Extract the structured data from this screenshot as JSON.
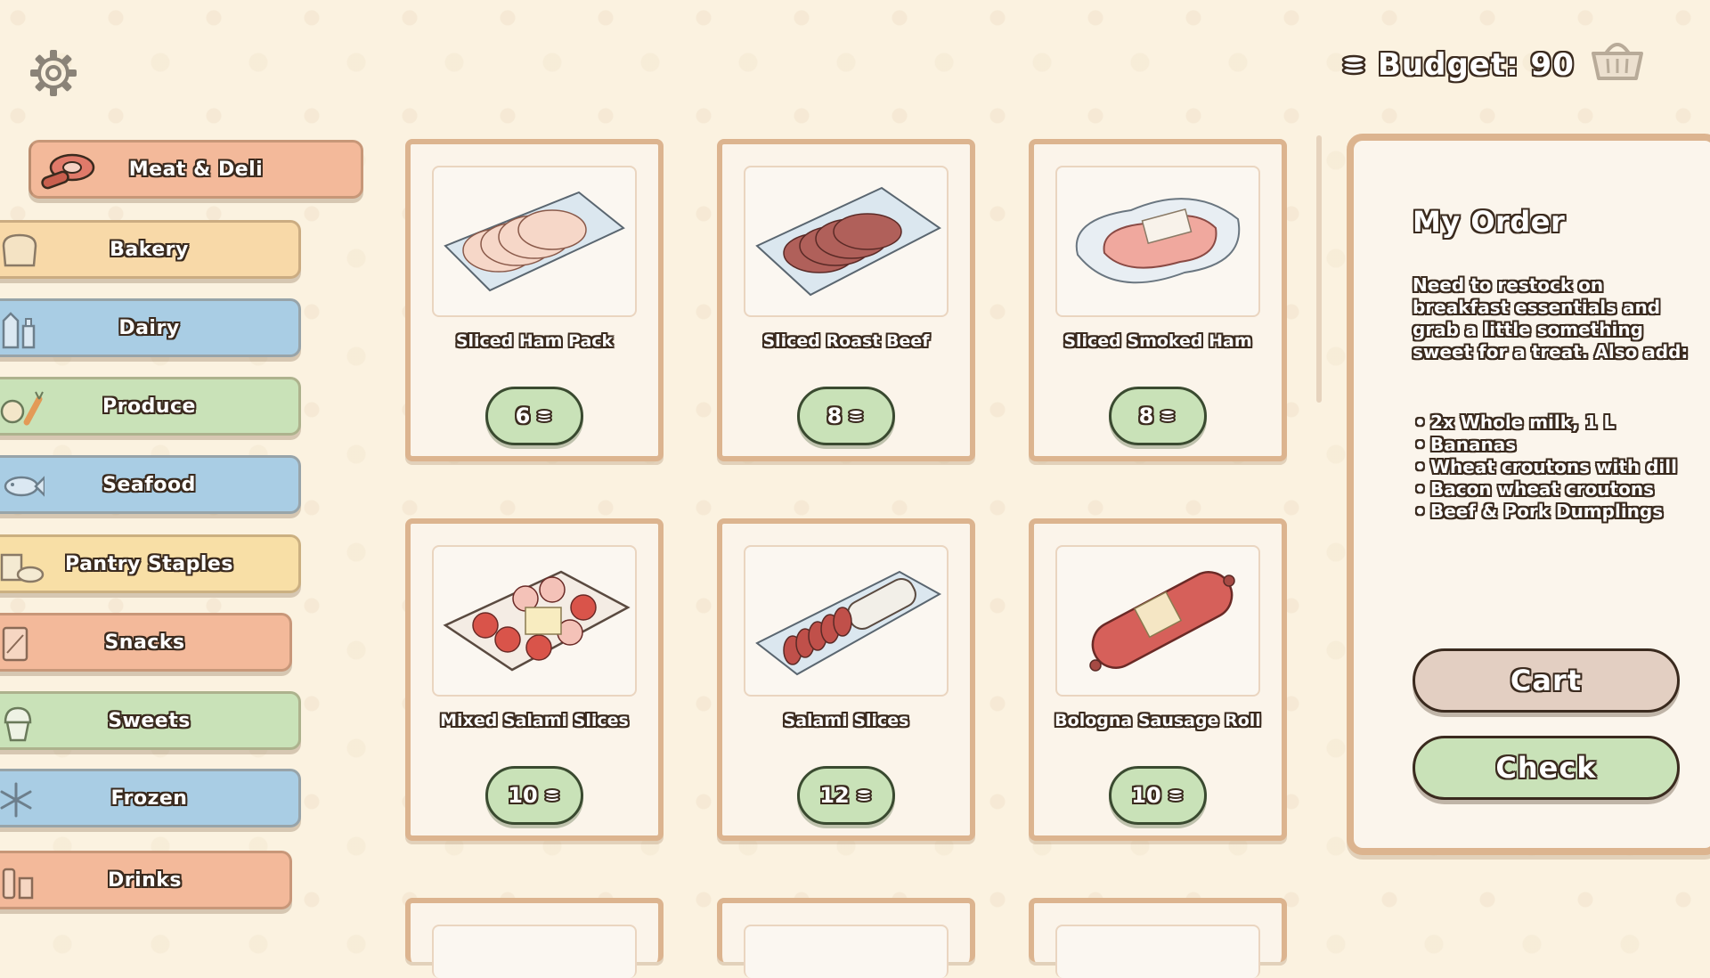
{
  "header": {
    "budget_label": "Budget: 90",
    "settings_icon": "gear-icon",
    "basket_icon": "basket-icon",
    "coins_icon": "coins-icon"
  },
  "categories": [
    {
      "label": "Meat & Deli",
      "icon": "steak-icon",
      "color": "#f3b99a",
      "active": true
    },
    {
      "label": "Bakery",
      "icon": "bread-icon",
      "color": "#f8d9a8"
    },
    {
      "label": "Dairy",
      "icon": "milk-icon",
      "color": "#a9cde4"
    },
    {
      "label": "Produce",
      "icon": "apple-carrot-icon",
      "color": "#c9e2b8"
    },
    {
      "label": "Seafood",
      "icon": "fish-icon",
      "color": "#a9cde4"
    },
    {
      "label": "Pantry Staples",
      "icon": "pantry-icon",
      "color": "#f8dfa6"
    },
    {
      "label": "Snacks",
      "icon": "snack-icon",
      "color": "#f3b99a"
    },
    {
      "label": "Sweets",
      "icon": "cupcake-icon",
      "color": "#c9e2b8"
    },
    {
      "label": "Frozen",
      "icon": "snowflake-icon",
      "color": "#a9cde4"
    },
    {
      "label": "Drinks",
      "icon": "bottles-icon",
      "color": "#f3b99a"
    }
  ],
  "products": [
    {
      "name": "Sliced Ham Pack",
      "price": "6",
      "image": "ham-pack-image"
    },
    {
      "name": "Sliced Roast Beef",
      "price": "8",
      "image": "roast-beef-image"
    },
    {
      "name": "Sliced Smoked Ham",
      "price": "8",
      "image": "smoked-ham-image"
    },
    {
      "name": "Mixed Salami Slices",
      "price": "10",
      "image": "mixed-salami-image"
    },
    {
      "name": "Salami Slices",
      "price": "12",
      "image": "salami-image"
    },
    {
      "name": "Bologna Sausage Roll",
      "price": "10",
      "image": "bologna-image"
    }
  ],
  "order": {
    "title": "My Order",
    "description": "Need to restock on breakfast essentials and grab a little something sweet for a treat. Also add:",
    "items": [
      "2x Whole milk, 1 L",
      "Bananas",
      "Wheat croutons with dill",
      "Bacon wheat croutons",
      "Beef & Pork Dumplings"
    ],
    "cart_label": "Cart",
    "check_label": "Check"
  },
  "colors": {
    "background": "#fbf2e0",
    "card_border": "#dcb48f",
    "price_pill": "#c9e2b8",
    "text_outline": "#3a2a1e"
  }
}
